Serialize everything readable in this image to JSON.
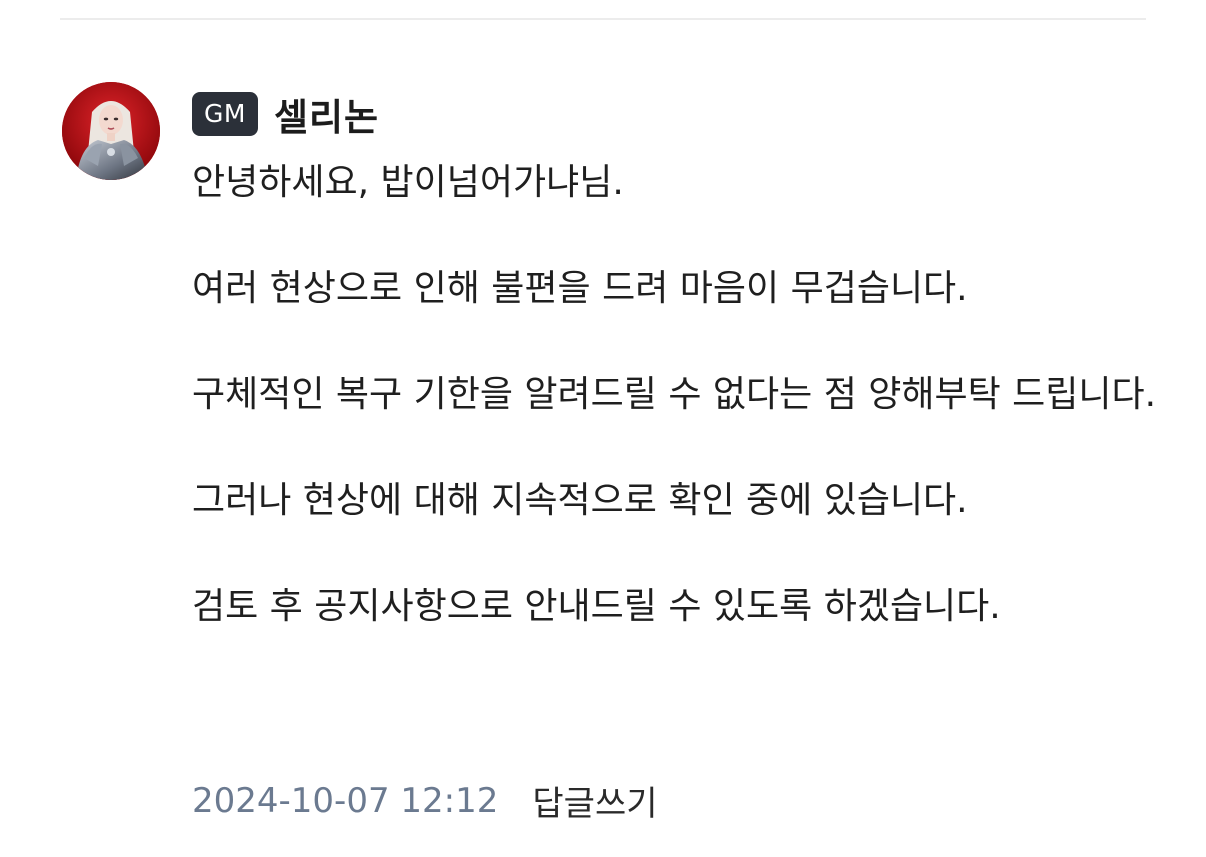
{
  "comment": {
    "avatar_icon": "character-portrait-avatar",
    "badge": "GM",
    "author": "셀리논",
    "paragraphs": [
      "안녕하세요, 밥이넘어가냐님.",
      "여러 현상으로 인해 불편을 드려 마음이 무겁습니다.",
      "구체적인 복구 기한을 알려드릴 수 없다는 점 양해부탁 드립니다.",
      "그러나 현상에 대해 지속적으로 확인 중에 있습니다.",
      "검토 후 공지사항으로 안내드릴 수 있도록 하겠습니다."
    ],
    "date": "2024-10-07 12:12",
    "reply_label": "답글쓰기"
  },
  "colors": {
    "badge_bg": "#2b3039",
    "date_text": "#6b7a90",
    "avatar_bg": "#b10d12"
  }
}
